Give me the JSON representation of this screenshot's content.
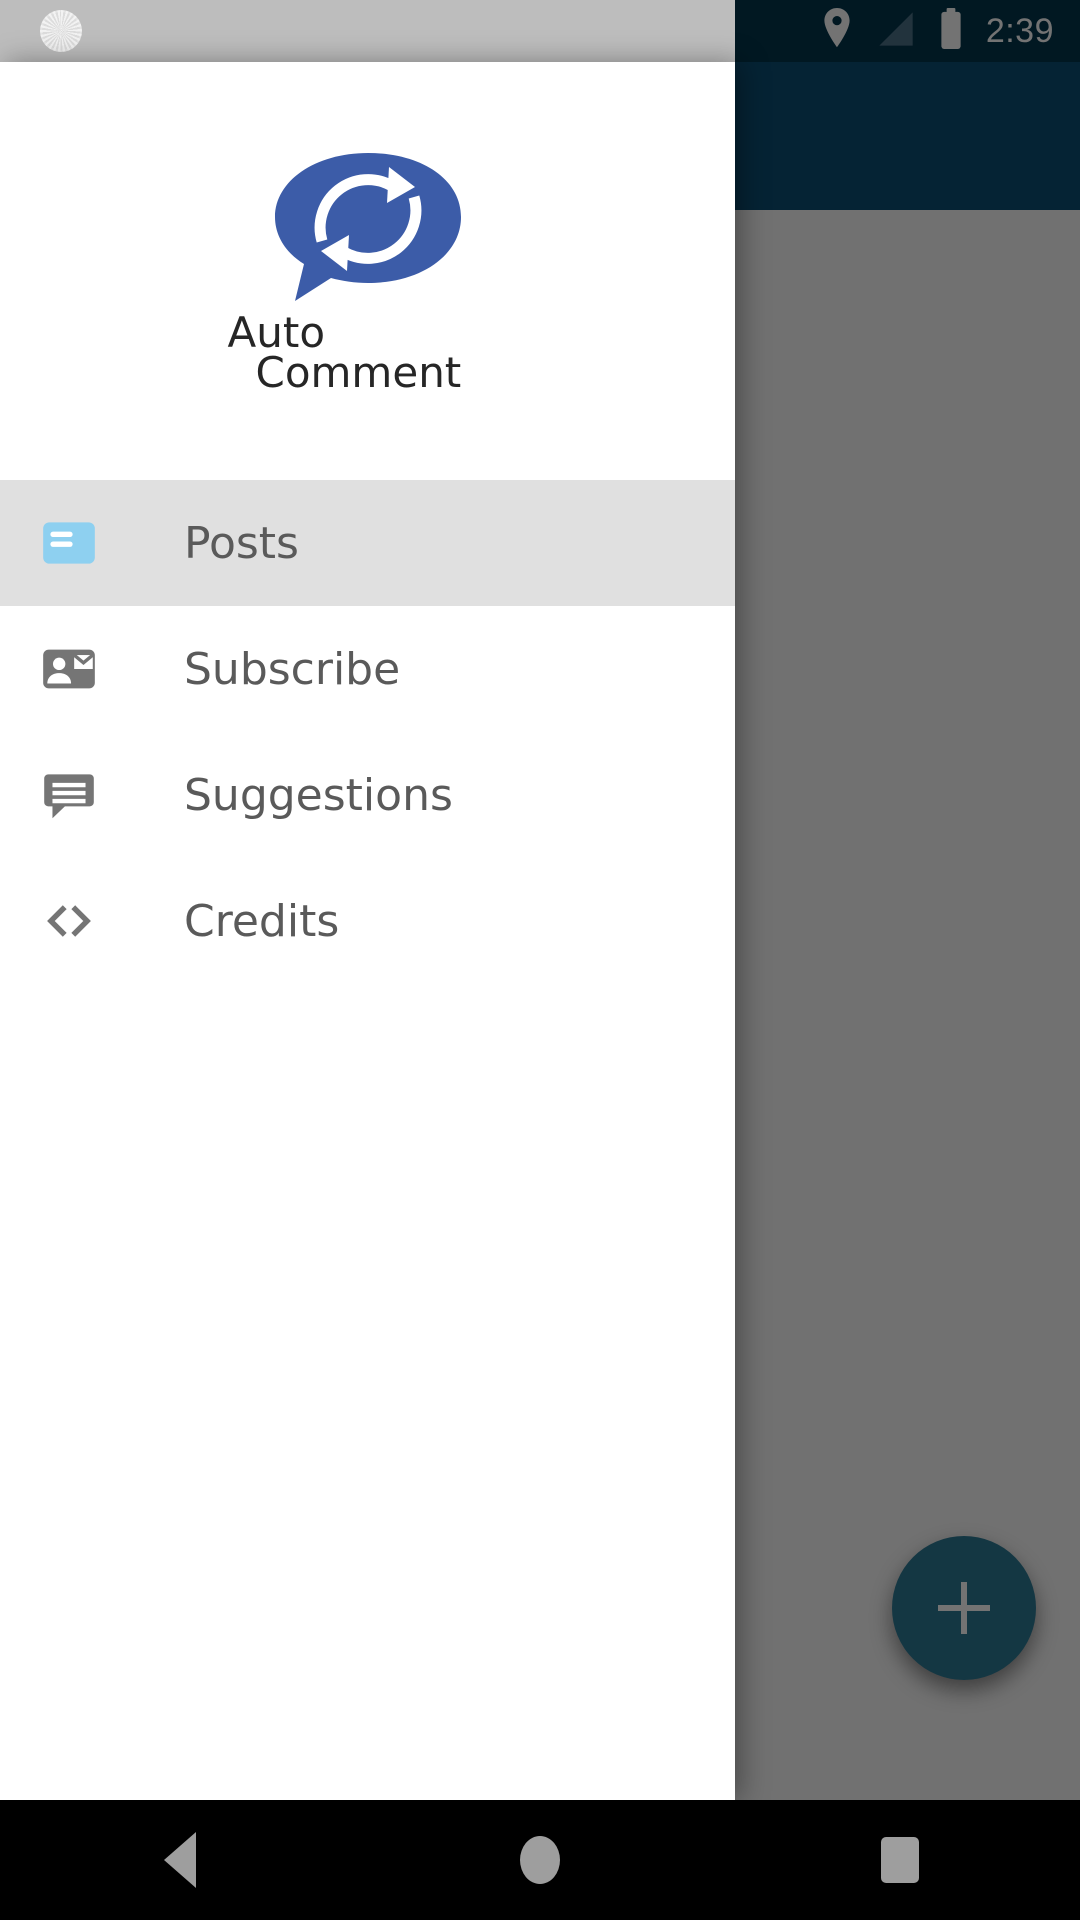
{
  "status_bar": {
    "time": "2:39",
    "icons": [
      "location-pin-icon",
      "signal-cellular-icon",
      "battery-full-icon"
    ],
    "left_overlay_icon": "sync-spinner-icon",
    "background_color": "#03354d",
    "overlay_color": "#bdbdbd"
  },
  "drawer": {
    "header": {
      "logo_icon": "auto-comment-logo-icon",
      "brand_line1": "Auto",
      "brand_line2": "Comment",
      "logo_color": "#3c5ca8"
    },
    "items": [
      {
        "label": "Posts",
        "icon": "article-list-icon",
        "selected": true,
        "icon_color": "#8ed0f0"
      },
      {
        "label": "Subscribe",
        "icon": "contact-mail-icon",
        "selected": false,
        "icon_color": "#757575"
      },
      {
        "label": "Suggestions",
        "icon": "comment-icon",
        "selected": false,
        "icon_color": "#757575"
      },
      {
        "label": "Credits",
        "icon": "code-icon",
        "selected": false,
        "icon_color": "#757575"
      }
    ],
    "selected_background": "#e0e0e0",
    "background": "#ffffff"
  },
  "app_screen": {
    "app_bar_color": "#0d4f73",
    "body_color": "#fafafa",
    "fab": {
      "icon": "add-plus-icon",
      "color": "#2e7a96"
    },
    "scrim_color": "rgba(0,0,0,0.55)"
  },
  "navigation_bar": {
    "buttons": [
      {
        "name": "back",
        "icon": "triangle-back-icon"
      },
      {
        "name": "home",
        "icon": "circle-home-icon"
      },
      {
        "name": "recents",
        "icon": "square-recents-icon"
      }
    ],
    "background": "#000000"
  }
}
